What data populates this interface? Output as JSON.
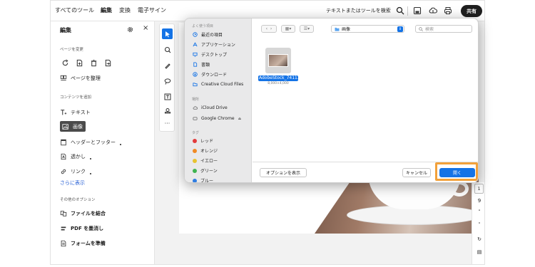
{
  "topbar": {
    "menu": [
      "すべてのツール",
      "編集",
      "変換",
      "電子サイン"
    ],
    "search_label": "テキストまたはツールを検索",
    "share_label": "共有"
  },
  "leftpanel": {
    "title": "編集",
    "section_page": "ページを変更",
    "organize_label": "ページを整理",
    "section_content": "コンテンツを追加",
    "items": [
      "テキスト",
      "画像",
      "ヘッダーとフッター",
      "透かし",
      "リンク"
    ],
    "more_link": "さらに表示",
    "section_other": "その他のオプション",
    "other_items": [
      "ファイルを結合",
      "PDF を墨消し",
      "フォームを準備"
    ]
  },
  "rightpanel": {
    "page_current": "1",
    "page_total": "9"
  },
  "dialog": {
    "favorites_head": "よく使う項目",
    "favorites": [
      "最近の項目",
      "アプリケーション",
      "デスクトップ",
      "書類",
      "ダウンロード",
      "Creative Cloud Files"
    ],
    "locations_head": "場所",
    "locations": [
      "iCloud Drive",
      "Google Chrome"
    ],
    "tags_head": "タグ",
    "tags": [
      {
        "label": "レッド",
        "color": "#e23b3b"
      },
      {
        "label": "オレンジ",
        "color": "#f08a24"
      },
      {
        "label": "イエロー",
        "color": "#e8c230"
      },
      {
        "label": "グリーン",
        "color": "#3fb34f"
      },
      {
        "label": "ブルー",
        "color": "#2f7de1"
      }
    ],
    "location_value": "画像",
    "search_placeholder": "検索",
    "file_name": "AdobeStock_741138277.jpeg",
    "file_dims": "8,000×4,000",
    "options_label": "オプションを表示",
    "cancel_label": "キャンセル",
    "open_label": "開く"
  }
}
